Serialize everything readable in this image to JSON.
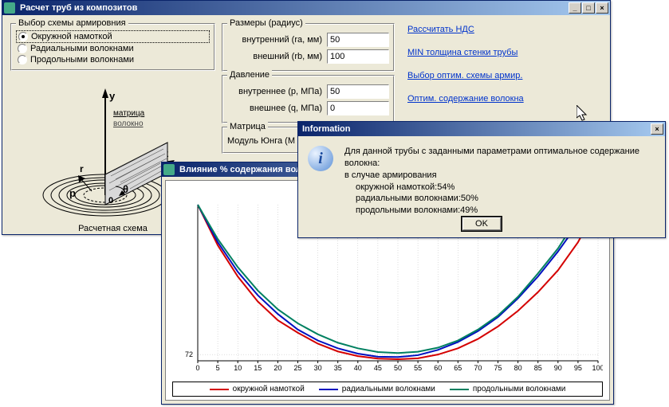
{
  "mainWindow": {
    "title": "Расчет труб из композитов",
    "schemeGroup": {
      "legend": "Выбор схемы армировния",
      "options": [
        "Окружной намоткой",
        "Радиальными волокнами",
        "Продольными волокнами"
      ],
      "selected": 0
    },
    "schemeCaption": "Расчетная схема",
    "sizeGroup": {
      "legend": "Размеры (радиус)",
      "inner": {
        "label": "внутренний (ra, мм)",
        "value": "50"
      },
      "outer": {
        "label": "внешний (rb, мм)",
        "value": "100"
      }
    },
    "pressureGroup": {
      "legend": "Давление",
      "inner": {
        "label": "внутреннее (p, МПа)",
        "value": "50"
      },
      "outer": {
        "label": "внешнее (q, МПа)",
        "value": "0"
      }
    },
    "matrixGroup": {
      "legend": "Матрица",
      "youngLabel": "Модуль Юнга (М"
    },
    "actions": {
      "calc": "Рассчитать НДС",
      "minThick": "MIN толщина стенки трубы",
      "optScheme": "Выбор оптим. схемы армир.",
      "optFiber": "Оптим. содержание волокна"
    }
  },
  "chartWindow": {
    "title": "Влияние % содержания волокна на ра",
    "chartTitle": "Влияние % содержания волокна на ра"
  },
  "chart_data": {
    "type": "line",
    "xlabel": "",
    "ylabel": "",
    "xlim": [
      0,
      100
    ],
    "ylim": [
      70,
      120
    ],
    "x": [
      0,
      5,
      10,
      15,
      20,
      25,
      30,
      35,
      40,
      45,
      50,
      55,
      60,
      65,
      70,
      75,
      80,
      85,
      90,
      95,
      100
    ],
    "series": [
      {
        "name": "окружной намоткой",
        "color": "#d40000",
        "y": [
          120,
          107,
          97,
          89,
          83,
          79,
          75.5,
          73,
          71.5,
          70.7,
          70.5,
          70.8,
          72,
          74,
          77,
          81,
          86,
          92,
          99,
          108,
          120
        ]
      },
      {
        "name": "радиальными волокнами",
        "color": "#0010c0",
        "y": [
          120,
          108,
          98.5,
          91,
          85,
          80,
          76.5,
          74,
          72.3,
          71.3,
          71.2,
          71.8,
          73.5,
          76,
          79.5,
          84,
          90,
          97,
          105,
          114,
          125
        ]
      },
      {
        "name": "продольными волокнами",
        "color": "#008060",
        "y": [
          120,
          109,
          100,
          92.5,
          86.5,
          82,
          78.5,
          75.8,
          74,
          72.8,
          72.5,
          72.9,
          74.2,
          76.5,
          80,
          84.5,
          90.5,
          98,
          106,
          116,
          128
        ]
      }
    ],
    "xticks": [
      0,
      5,
      10,
      15,
      20,
      25,
      30,
      35,
      40,
      45,
      50,
      55,
      60,
      65,
      70,
      75,
      80,
      85,
      90,
      95,
      100
    ],
    "ytick": 72
  },
  "infoDialog": {
    "title": "Information",
    "text": "Для данной трубы с заданными параметрами оптимальное содержание волокна:",
    "sub": "в случае армирования",
    "lines": [
      "окружной намоткой:54%",
      "радиальными волокнами:50%",
      "продольными волокнами:49%"
    ],
    "ok": "OK"
  }
}
